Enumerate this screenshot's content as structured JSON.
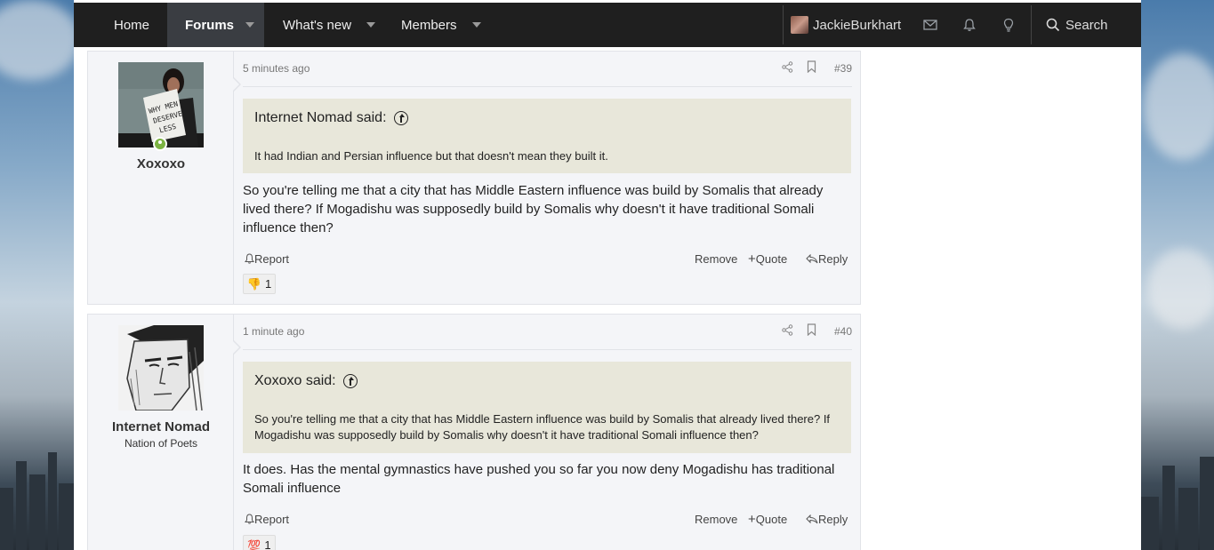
{
  "nav": {
    "home": "Home",
    "forums": "Forums",
    "whats_new": "What's new",
    "members": "Members",
    "username": "JackieBurkhart",
    "search": "Search"
  },
  "posts": [
    {
      "time": "5 minutes ago",
      "number": "#39",
      "author": "Xoxoxo",
      "avatar_text": "WHY MEN DESERVE LESS",
      "quote_author": "Internet Nomad said:",
      "quote_text": "It had Indian and Persian influence but that doesn't mean they built it.",
      "message": "So you're telling me that a city that has Middle Eastern influence was build by Somalis that already lived there? If Mogadishu was supposedly build by Somalis why doesn't it have traditional Somali influence then?",
      "report": "Report",
      "remove": "Remove",
      "quote": "Quote",
      "reply": "Reply",
      "reaction_icon": "👎",
      "reaction_count": "1"
    },
    {
      "time": "1 minute ago",
      "number": "#40",
      "author": "Internet Nomad",
      "user_title": "Nation of Poets",
      "quote_author": "Xoxoxo said:",
      "quote_text": "So you're telling me that a city that has Middle Eastern influence was build by Somalis that already lived there? If Mogadishu was supposedly build by Somalis why doesn't it have traditional Somali influence then?",
      "message": "It does. Has the mental gymnastics have pushed you so far you now deny Mogadishu has traditional Somali influence",
      "report": "Report",
      "remove": "Remove",
      "quote": "Quote",
      "reply": "Reply",
      "reaction_icon": "💯",
      "reaction_count": "1"
    }
  ]
}
